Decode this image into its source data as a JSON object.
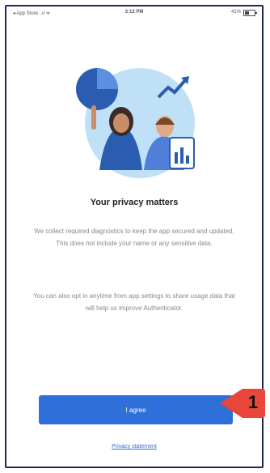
{
  "status_bar": {
    "left": "◂ App Store ..ıl ᯤ",
    "time": "3:12 PM",
    "battery": "41%"
  },
  "content": {
    "title": "Your privacy matters",
    "paragraph_1": "We collect required diagnostics to keep the app secured and updated. This does not include your name or any sensitive data.",
    "paragraph_2": "You can also opt in anytime from app settings to share usage data that will help us improve Authenticator.",
    "agree_label": "I agree",
    "privacy_link": "Privacy statement"
  },
  "annotation": {
    "step_number": "1"
  },
  "colors": {
    "accent": "#2f6fd9",
    "callout": "#e8463a",
    "frame": "#1d2a57"
  }
}
